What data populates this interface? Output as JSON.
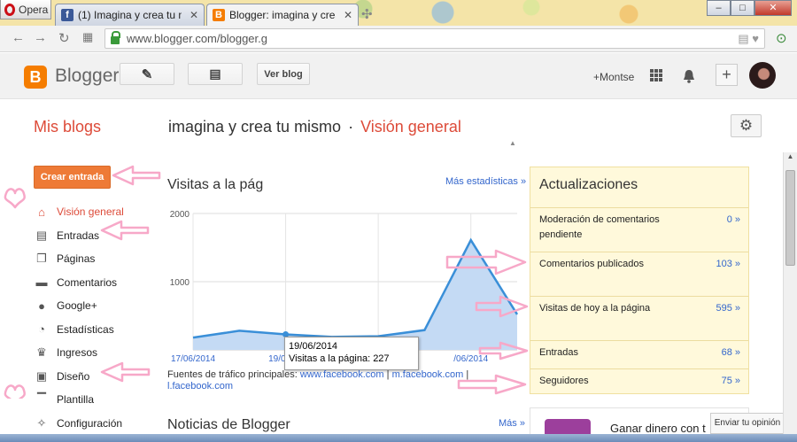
{
  "browser": {
    "opera_label": "Opera",
    "tabs": [
      {
        "title": "(1) Imagina y crea tu mism",
        "favicon": "facebook-icon"
      },
      {
        "title": "Blogger: imagina y crea tu",
        "favicon": "blogger-icon"
      }
    ],
    "url": "www.blogger.com/blogger.g"
  },
  "header": {
    "brand": "Blogger",
    "view_blog": "Ver blog",
    "user": "+Montse"
  },
  "title_row": {
    "my_blogs": "Mis blogs",
    "blog_name": "imagina y crea tu mismo",
    "separator": "·",
    "section": "Visión general"
  },
  "sidebar": {
    "create_label": "Crear entrada",
    "items": [
      {
        "label": "Visión general",
        "icon": "home-icon",
        "active": true
      },
      {
        "label": "Entradas",
        "icon": "posts-icon"
      },
      {
        "label": "Páginas",
        "icon": "pages-icon"
      },
      {
        "label": "Comentarios",
        "icon": "comment-icon"
      },
      {
        "label": "Google+",
        "icon": "google-plus-icon"
      },
      {
        "label": "Estadísticas",
        "icon": "pie-chart-icon"
      },
      {
        "label": "Ingresos",
        "icon": "trophy-icon"
      },
      {
        "label": "Diseño",
        "icon": "layout-icon"
      },
      {
        "label": "Plantilla",
        "icon": "paint-roller-icon"
      },
      {
        "label": "Configuración",
        "icon": "wrench-icon"
      }
    ]
  },
  "stats": {
    "title": "Visitas a la pág",
    "more_link": "Más estadísticas »",
    "sources_label": "Fuentes de tráfico principales:",
    "sources": [
      "www.facebook.com",
      "m.facebook.com",
      "l.facebook.com"
    ],
    "tooltip_date": "19/06/2014",
    "tooltip_value": "Visitas a la página: 227"
  },
  "chart_data": {
    "type": "area",
    "y_ticks": [
      "2000",
      "1000"
    ],
    "ylim": [
      0,
      2000
    ],
    "x_tick_labels": [
      "17/06/2014",
      "19/06/20",
      "/06/2014"
    ],
    "values": [
      180,
      280,
      227,
      190,
      200,
      290,
      1610,
      520
    ],
    "highlight_index": 2,
    "color": "#3a8fd8"
  },
  "updates": {
    "title": "Actualizaciones",
    "rows": [
      {
        "label": "Moderación de comentarios pendiente",
        "value": "0 »"
      },
      {
        "label": "Comentarios publicados",
        "value": "103 »"
      },
      {
        "label": "Visitas de hoy a la página",
        "value": "595 »"
      },
      {
        "label": "Entradas",
        "value": "68 »"
      },
      {
        "label": "Seguidores",
        "value": "75 »"
      }
    ]
  },
  "news": {
    "title": "Noticias de Blogger",
    "more_link": "Más »"
  },
  "ad": {
    "text": "Ganar dinero con t"
  },
  "feedback_label": "Enviar tu opinión",
  "colors": {
    "accent": "#dd4b39",
    "create_button": "#ee7a36",
    "link": "#3366cc",
    "updates_bg": "#fff9db",
    "annotation_pink": "#f7a8c8"
  }
}
